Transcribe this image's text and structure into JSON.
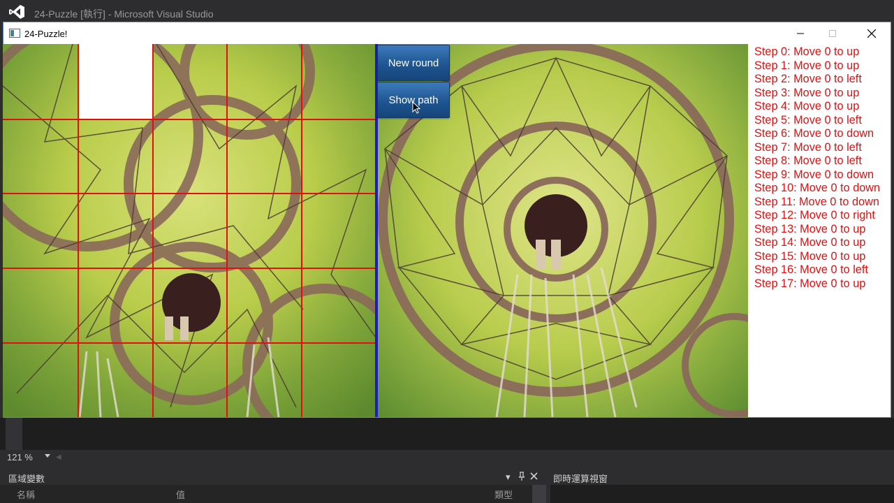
{
  "vs": {
    "title": "24-Puzzle [執行] - Microsoft Visual Studio"
  },
  "app": {
    "title": "24-Puzzle!",
    "buttons": {
      "new_round": "New round",
      "show_path": "Show path"
    },
    "steps": [
      "Step 0: Move 0 to up",
      "Step 1: Move 0 to up",
      "Step 2: Move 0 to left",
      "Step 3: Move 0 to up",
      "Step 4: Move 0 to up",
      "Step 5: Move 0 to left",
      "Step 6: Move 0 to down",
      "Step 7: Move 0 to left",
      "Step 8: Move 0 to left",
      "Step 9: Move 0 to down",
      "Step 10: Move 0 to down",
      "Step 11: Move 0 to down",
      "Step 12: Move 0 to right",
      "Step 13: Move 0 to up",
      "Step 14: Move 0 to up",
      "Step 15: Move 0 to up",
      "Step 16: Move 0 to left",
      "Step 17: Move 0 to up"
    ],
    "colors": {
      "grid": "#e01010",
      "divider": "#1a1ad0",
      "steps_text": "#e01010",
      "button": "#1f5592"
    }
  },
  "debug": {
    "zoom": "121 %",
    "locals": {
      "title": "區域變數",
      "columns": [
        "名稱",
        "值",
        "類型"
      ]
    },
    "immediate": {
      "title": "即時運算視窗"
    }
  }
}
